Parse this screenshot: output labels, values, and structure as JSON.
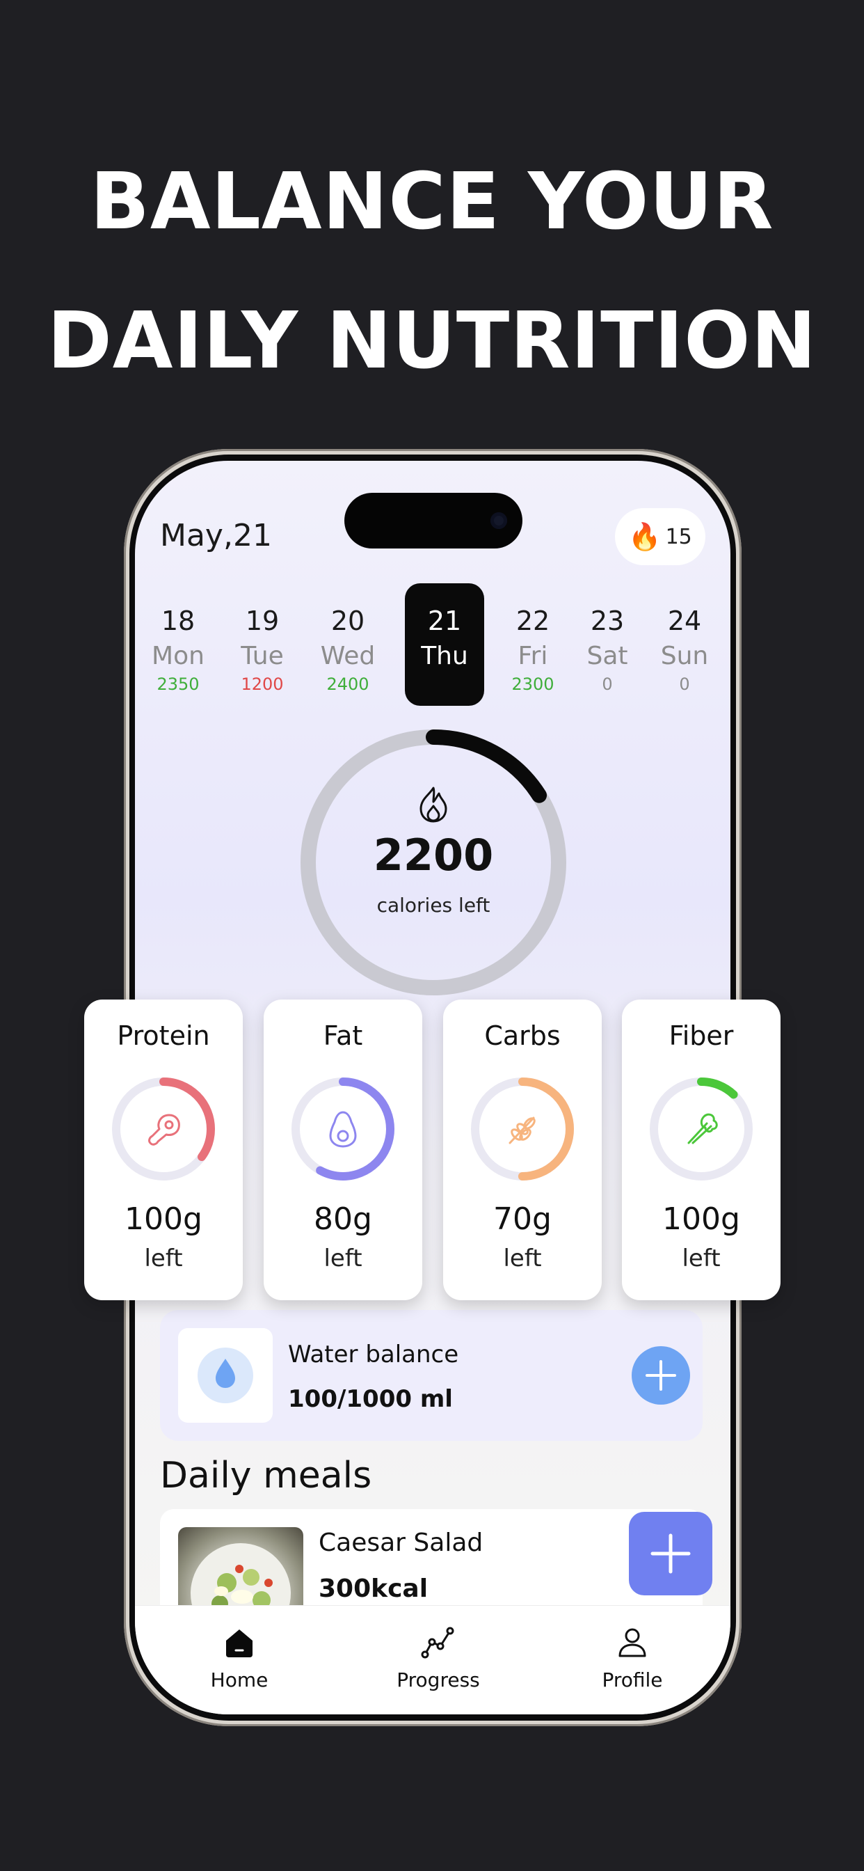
{
  "headline": {
    "line1": "BALANCE YOUR",
    "line2": "DAILY NUTRITION"
  },
  "status": {
    "date": "May,21",
    "streak_count": "15",
    "streak_icon": "fire-icon"
  },
  "week": [
    {
      "num": "18",
      "name": "Mon",
      "kcal": "2350",
      "kcal_color": "#3fae3a",
      "active": false
    },
    {
      "num": "19",
      "name": "Tue",
      "kcal": "1200",
      "kcal_color": "#e04848",
      "active": false
    },
    {
      "num": "20",
      "name": "Wed",
      "kcal": "2400",
      "kcal_color": "#3fae3a",
      "active": false
    },
    {
      "num": "21",
      "name": "Thu",
      "kcal": "",
      "kcal_color": "#ffffff",
      "active": true
    },
    {
      "num": "22",
      "name": "Fri",
      "kcal": "2300",
      "kcal_color": "#3fae3a",
      "active": false
    },
    {
      "num": "23",
      "name": "Sat",
      "kcal": "0",
      "kcal_color": "#8c8c8c",
      "active": false
    },
    {
      "num": "24",
      "name": "Sun",
      "kcal": "0",
      "kcal_color": "#8c8c8c",
      "active": false
    }
  ],
  "calories": {
    "value": "2200",
    "label": "calories left",
    "progress": 0.16,
    "ring_color": "#0a0a0a",
    "track_color": "#c9c9d1"
  },
  "macros": [
    {
      "title": "Protein",
      "amount": "100g",
      "left": "left",
      "progress": 0.35,
      "color": "#e8717a",
      "icon": "meat-icon"
    },
    {
      "title": "Fat",
      "amount": "80g",
      "left": "left",
      "progress": 0.58,
      "color": "#8d86ef",
      "icon": "avocado-icon"
    },
    {
      "title": "Carbs",
      "amount": "70g",
      "left": "left",
      "progress": 0.5,
      "color": "#f7b47e",
      "icon": "wheat-icon"
    },
    {
      "title": "Fiber",
      "amount": "100g",
      "left": "left",
      "progress": 0.12,
      "color": "#4bc73a",
      "icon": "celery-icon"
    }
  ],
  "water": {
    "title": "Water balance",
    "value": "100/1000 ml"
  },
  "meals": {
    "title": "Daily meals",
    "items": [
      {
        "name": "Caesar Salad",
        "kcal": "300kcal"
      }
    ]
  },
  "tabs": [
    {
      "label": "Home",
      "icon": "home-icon",
      "active": true
    },
    {
      "label": "Progress",
      "icon": "progress-chart-icon",
      "active": false
    },
    {
      "label": "Profile",
      "icon": "profile-icon",
      "active": false
    }
  ]
}
